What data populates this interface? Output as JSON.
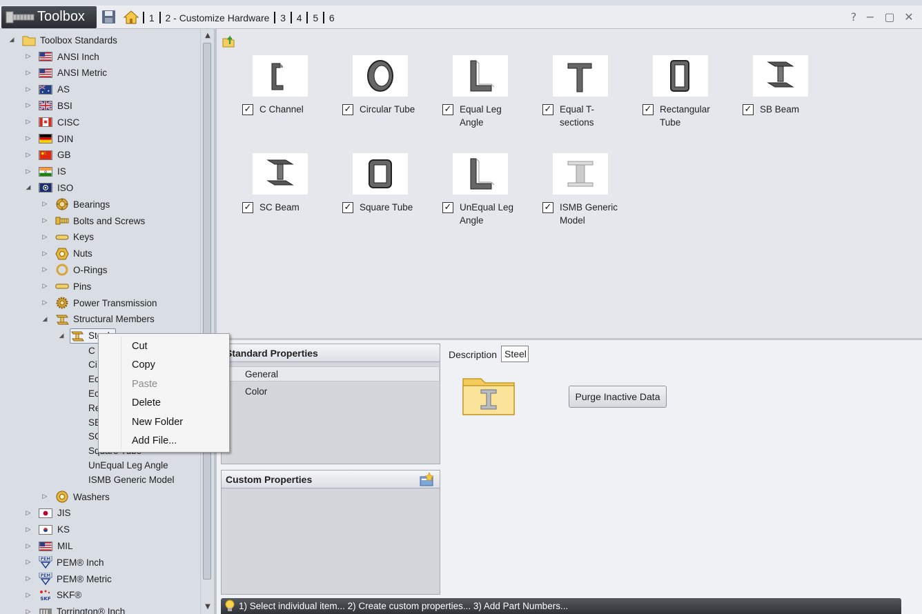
{
  "titlebar": {
    "app_title": "Toolbox",
    "crumbs": [
      "1",
      "2 - Customize Hardware",
      "3",
      "4",
      "5",
      "6"
    ],
    "window_buttons": [
      "help-icon",
      "minimize-icon",
      "maximize-icon",
      "close-icon"
    ]
  },
  "tree": {
    "root": "Toolbox Standards",
    "standards": [
      {
        "label": "ANSI Inch",
        "icon": "usa-flag"
      },
      {
        "label": "ANSI Metric",
        "icon": "usa-flag"
      },
      {
        "label": "AS",
        "icon": "australia-flag"
      },
      {
        "label": "BSI",
        "icon": "uk-flag"
      },
      {
        "label": "CISC",
        "icon": "canada-flag"
      },
      {
        "label": "DIN",
        "icon": "germany-flag"
      },
      {
        "label": "GB",
        "icon": "china-flag"
      },
      {
        "label": "IS",
        "icon": "india-flag"
      },
      {
        "label": "ISO",
        "icon": "iso-flag"
      }
    ],
    "iso_children": [
      "Bearings",
      "Bolts and Screws",
      "Keys",
      "Nuts",
      "O-Rings",
      "Pins",
      "Power Transmission",
      "Structural Members"
    ],
    "selected_folder": "Steel",
    "steel_children_visible": [
      "C",
      "Ci",
      "Ec",
      "Ec",
      "Re",
      "SE",
      "SC",
      "Square Tube",
      "UnEqual Leg Angle",
      "ISMB Generic Model"
    ],
    "washers": "Washers",
    "standards_after": [
      {
        "label": "JIS",
        "icon": "japan-flag"
      },
      {
        "label": "KS",
        "icon": "korea-flag"
      },
      {
        "label": "MIL",
        "icon": "usa-flag"
      },
      {
        "label": "PEM® Inch",
        "icon": "pem-logo"
      },
      {
        "label": "PEM® Metric",
        "icon": "pem-logo"
      },
      {
        "label": "SKF®",
        "icon": "skf-logo"
      },
      {
        "label": "Torrington® Inch",
        "icon": "torrington-logo"
      }
    ]
  },
  "gallery": {
    "items": [
      {
        "label": "C Channel",
        "checked": true,
        "icon": "c-channel-icon"
      },
      {
        "label": "Circular Tube",
        "checked": true,
        "icon": "circular-tube-icon"
      },
      {
        "label": "Equal Leg Angle",
        "checked": true,
        "icon": "angle-icon"
      },
      {
        "label": "Equal T-sections",
        "checked": true,
        "icon": "t-section-icon"
      },
      {
        "label": "Rectangular Tube",
        "checked": true,
        "icon": "rect-tube-icon"
      },
      {
        "label": "SB Beam",
        "checked": true,
        "icon": "beam-icon"
      },
      {
        "label": "SC Beam",
        "checked": true,
        "icon": "beam-icon"
      },
      {
        "label": "Square Tube",
        "checked": true,
        "icon": "square-tube-icon"
      },
      {
        "label": "UnEqual Leg Angle",
        "checked": true,
        "icon": "angle-icon"
      },
      {
        "label": "ISMB Generic Model",
        "checked": true,
        "icon": "ismb-icon"
      }
    ],
    "check_glyph": "✓"
  },
  "standard_properties": {
    "title": "Standard Properties",
    "rows": [
      "General",
      "Color"
    ]
  },
  "custom_properties": {
    "title": "Custom Properties"
  },
  "details": {
    "description_label": "Description",
    "description_value": "Steel",
    "purge_button": "Purge Inactive Data"
  },
  "status": {
    "text": "1) Select individual item... 2) Create custom properties... 3) Add Part Numbers..."
  },
  "context_menu": {
    "items": [
      {
        "label": "Cut",
        "enabled": true
      },
      {
        "label": "Copy",
        "enabled": true
      },
      {
        "label": "Paste",
        "enabled": false
      },
      {
        "label": "Delete",
        "enabled": true
      },
      {
        "label": "New Folder",
        "enabled": true
      },
      {
        "label": "Add File...",
        "enabled": true
      }
    ]
  }
}
